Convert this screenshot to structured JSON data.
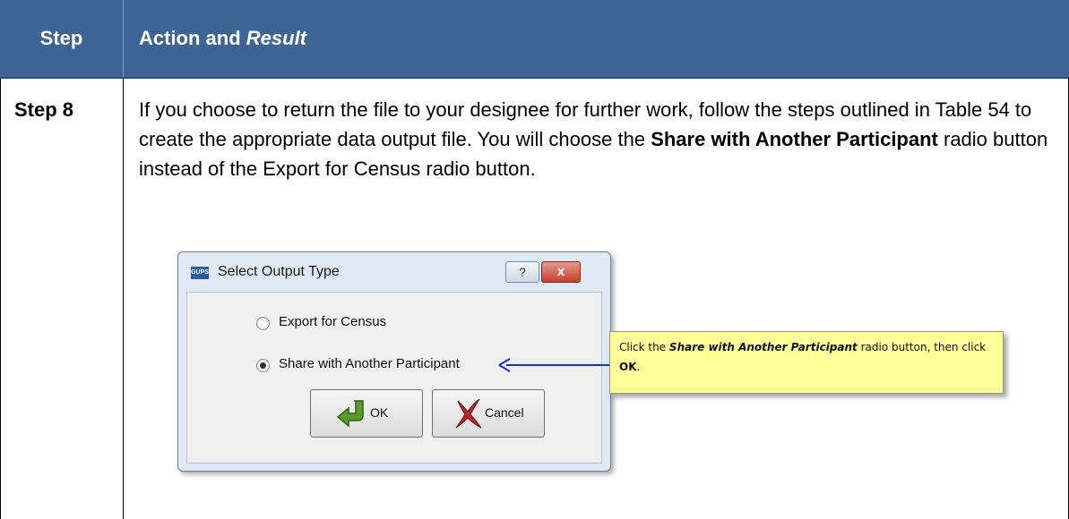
{
  "table": {
    "header": {
      "step": "Step",
      "action_prefix": "Action and ",
      "action_italic": "Result"
    },
    "row": {
      "step": "Step 8",
      "text_1": "If you choose to return the file to your designee for further work, follow the steps outlined in Table 54 to create the appropriate data output file. You will choose the ",
      "text_bold": "Share with Another Participant",
      "text_2": " radio button instead of the Export for Census radio button."
    }
  },
  "dialog": {
    "icon_text": "GUPS",
    "title": "Select Output Type",
    "help_label": "?",
    "close_label": "x",
    "options": [
      {
        "label": "Export for Census",
        "checked": false
      },
      {
        "label": "Share with Another Participant",
        "checked": true
      }
    ],
    "ok_label": "OK",
    "cancel_label": "Cancel"
  },
  "callout": {
    "prefix": "Click the ",
    "bold_italic": "Share with Another  Participant",
    "middle": " radio button, then click ",
    "bold": "OK",
    "suffix": "."
  },
  "colors": {
    "header_bg": "#3d6495",
    "callout_bg": "#ffff99",
    "arrow": "#1f2fd6",
    "close_button": "#c4402f"
  }
}
